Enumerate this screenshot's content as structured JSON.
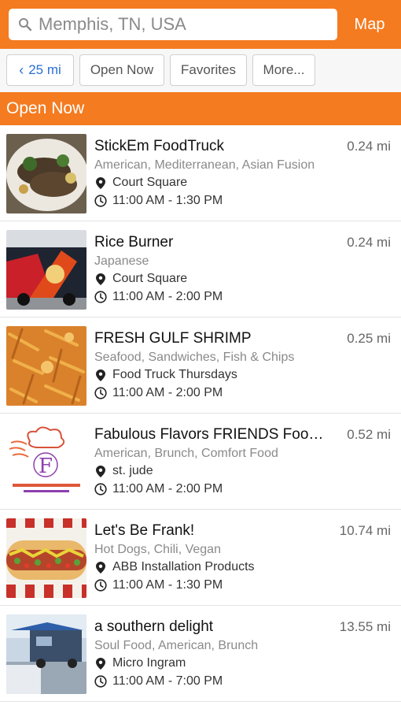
{
  "search": {
    "placeholder": "Memphis, TN, USA",
    "icon": "search-icon"
  },
  "header": {
    "map_label": "Map"
  },
  "filters": {
    "distance": "25 mi",
    "open_now": "Open Now",
    "favorites": "Favorites",
    "more": "More..."
  },
  "section": {
    "title": "Open Now"
  },
  "colors": {
    "accent": "#f47b20",
    "link": "#2a6fd6"
  },
  "trucks": [
    {
      "name": "StickEm FoodTruck",
      "distance": "0.24 mi",
      "categories": "American, Mediterranean, Asian Fusion",
      "location": "Court Square",
      "hours": "11:00 AM - 1:30 PM"
    },
    {
      "name": "Rice Burner",
      "distance": "0.24 mi",
      "categories": "Japanese",
      "location": "Court Square",
      "hours": "11:00 AM - 2:00 PM"
    },
    {
      "name": "FRESH GULF SHRIMP",
      "distance": "0.25 mi",
      "categories": "Seafood, Sandwiches, Fish & Chips",
      "location": "Food Truck Thursdays",
      "hours": "11:00 AM - 2:00 PM"
    },
    {
      "name": "Fabulous Flavors FRIENDS Foo…",
      "distance": "0.52 mi",
      "categories": "American, Brunch, Comfort Food",
      "location": "st. jude",
      "hours": "11:00 AM - 2:00 PM"
    },
    {
      "name": "Let's Be Frank!",
      "distance": "10.74 mi",
      "categories": "Hot Dogs, Chili, Vegan",
      "location": "ABB Installation Products",
      "hours": "11:00 AM - 1:30 PM"
    },
    {
      "name": "a southern delight",
      "distance": "13.55 mi",
      "categories": "Soul Food, American, Brunch",
      "location": "Micro Ingram",
      "hours": "11:00 AM - 7:00 PM"
    }
  ]
}
